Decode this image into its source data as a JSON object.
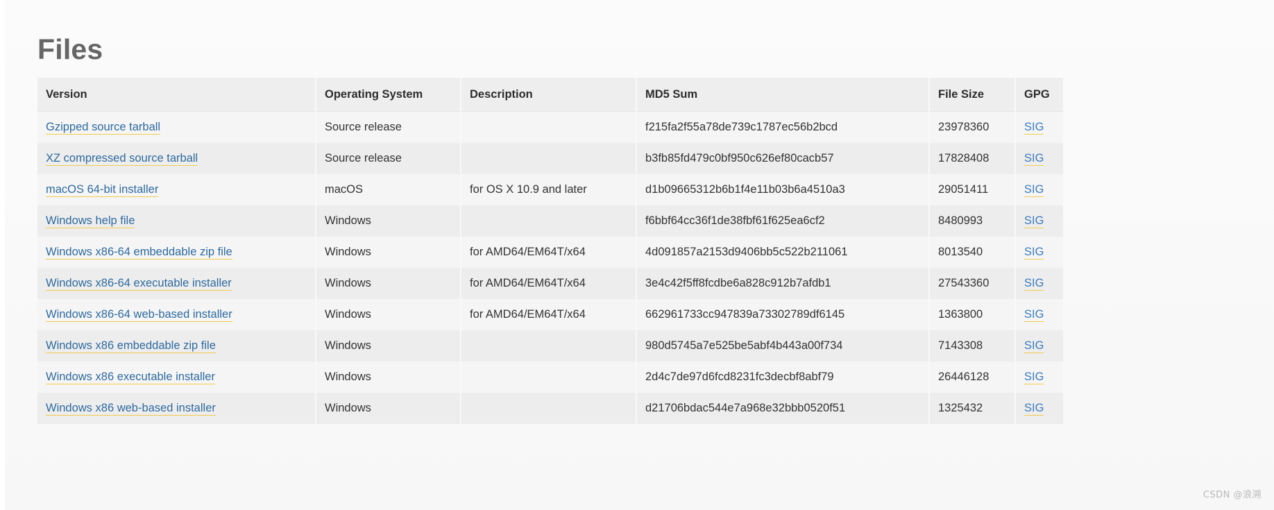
{
  "page": {
    "title": "Files",
    "watermark": "CSDN @浪溯",
    "link_color": "#2d6a9f",
    "link_underline_color": "#f2cb4d",
    "header_bg": "#eeeeee",
    "row_odd_bg": "#f5f5f5",
    "row_even_bg": "#ededed"
  },
  "table": {
    "columns": [
      {
        "key": "version",
        "label": "Version"
      },
      {
        "key": "os",
        "label": "Operating System"
      },
      {
        "key": "description",
        "label": "Description"
      },
      {
        "key": "md5",
        "label": "MD5 Sum"
      },
      {
        "key": "filesize",
        "label": "File Size"
      },
      {
        "key": "gpg",
        "label": "GPG"
      }
    ],
    "rows": [
      {
        "version": "Gzipped source tarball",
        "os": "Source release",
        "description": "",
        "md5": "f215fa2f55a78de739c1787ec56b2bcd",
        "filesize": "23978360",
        "gpg": "SIG"
      },
      {
        "version": "XZ compressed source tarball",
        "os": "Source release",
        "description": "",
        "md5": "b3fb85fd479c0bf950c626ef80cacb57",
        "filesize": "17828408",
        "gpg": "SIG"
      },
      {
        "version": "macOS 64-bit installer",
        "os": "macOS",
        "description": "for OS X 10.9 and later",
        "md5": "d1b09665312b6b1f4e11b03b6a4510a3",
        "filesize": "29051411",
        "gpg": "SIG"
      },
      {
        "version": "Windows help file",
        "os": "Windows",
        "description": "",
        "md5": "f6bbf64cc36f1de38fbf61f625ea6cf2",
        "filesize": "8480993",
        "gpg": "SIG"
      },
      {
        "version": "Windows x86-64 embeddable zip file",
        "os": "Windows",
        "description": "for AMD64/EM64T/x64",
        "md5": "4d091857a2153d9406bb5c522b211061",
        "filesize": "8013540",
        "gpg": "SIG"
      },
      {
        "version": "Windows x86-64 executable installer",
        "os": "Windows",
        "description": "for AMD64/EM64T/x64",
        "md5": "3e4c42f5ff8fcdbe6a828c912b7afdb1",
        "filesize": "27543360",
        "gpg": "SIG"
      },
      {
        "version": "Windows x86-64 web-based installer",
        "os": "Windows",
        "description": "for AMD64/EM64T/x64",
        "md5": "662961733cc947839a73302789df6145",
        "filesize": "1363800",
        "gpg": "SIG"
      },
      {
        "version": "Windows x86 embeddable zip file",
        "os": "Windows",
        "description": "",
        "md5": "980d5745a7e525be5abf4b443a00f734",
        "filesize": "7143308",
        "gpg": "SIG"
      },
      {
        "version": "Windows x86 executable installer",
        "os": "Windows",
        "description": "",
        "md5": "2d4c7de97d6fcd8231fc3decbf8abf79",
        "filesize": "26446128",
        "gpg": "SIG"
      },
      {
        "version": "Windows x86 web-based installer",
        "os": "Windows",
        "description": "",
        "md5": "d21706bdac544e7a968e32bbb0520f51",
        "filesize": "1325432",
        "gpg": "SIG"
      }
    ]
  }
}
